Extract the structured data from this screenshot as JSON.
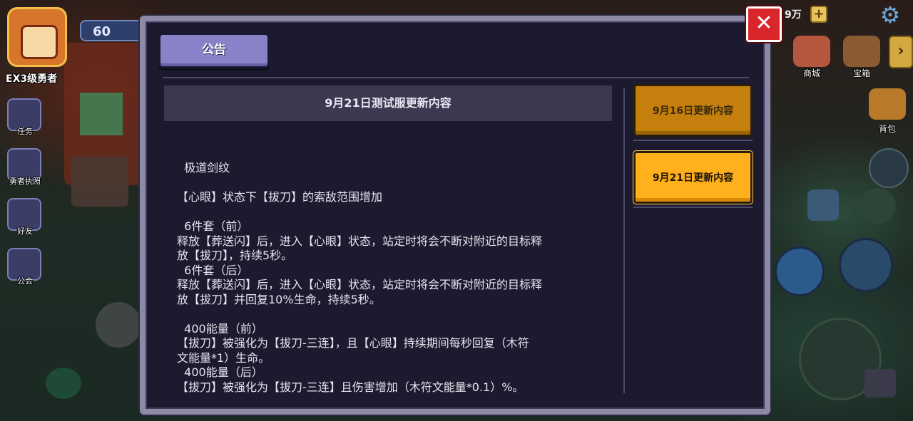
{
  "hud": {
    "level": "60",
    "rank": "EX3级勇者",
    "resource": "9万",
    "plus_symbol": "+",
    "side_menu": [
      {
        "label": "任务",
        "icon": "quest-icon"
      },
      {
        "label": "勇者执照",
        "icon": "license-icon"
      },
      {
        "label": "好友",
        "icon": "friends-icon"
      },
      {
        "label": "公会",
        "icon": "guild-icon"
      }
    ],
    "right_menu": [
      {
        "label": "商城",
        "icon": "shop-icon"
      },
      {
        "label": "宝箱",
        "icon": "chest-icon"
      },
      {
        "label": "背包",
        "icon": "backpack-icon"
      }
    ],
    "expand_symbol": "›",
    "gear_symbol": "⚙"
  },
  "dialog": {
    "tab_label": "公告",
    "close_symbol": "✕",
    "content_title": "9月21日测试服更新内容",
    "content_lines": [
      "  极道剑纹",
      "",
      "【心眼】状态下【拔刀】的索敌范围增加",
      "",
      "  6件套（前）",
      "释放【葬送闪】后，进入【心眼】状态，站定时将会不断对附近的目标释",
      "放【拔刀】，持续5秒。",
      "  6件套（后）",
      "释放【葬送闪】后，进入【心眼】状态，站定时将会不断对附近的目标释",
      "放【拔刀】并回复10%生命，持续5秒。",
      "",
      "  400能量（前）",
      "【拔刀】被强化为【拔刀-三连】，且【心眼】持续期间每秒回复（木符",
      "文能量*1）生命。",
      "  400能量（后）",
      "【拔刀】被强化为【拔刀-三连】且伤害增加（木符文能量*0.1）%。"
    ],
    "notices": [
      {
        "label": "9月16日更新内容",
        "selected": false
      },
      {
        "label": "9月21日更新内容",
        "selected": true
      }
    ]
  },
  "colors": {
    "notice_selected": "#ffb01c",
    "notice_unselected": "#c47f0c",
    "close": "#d8262a",
    "tab": "#8a82c9"
  }
}
